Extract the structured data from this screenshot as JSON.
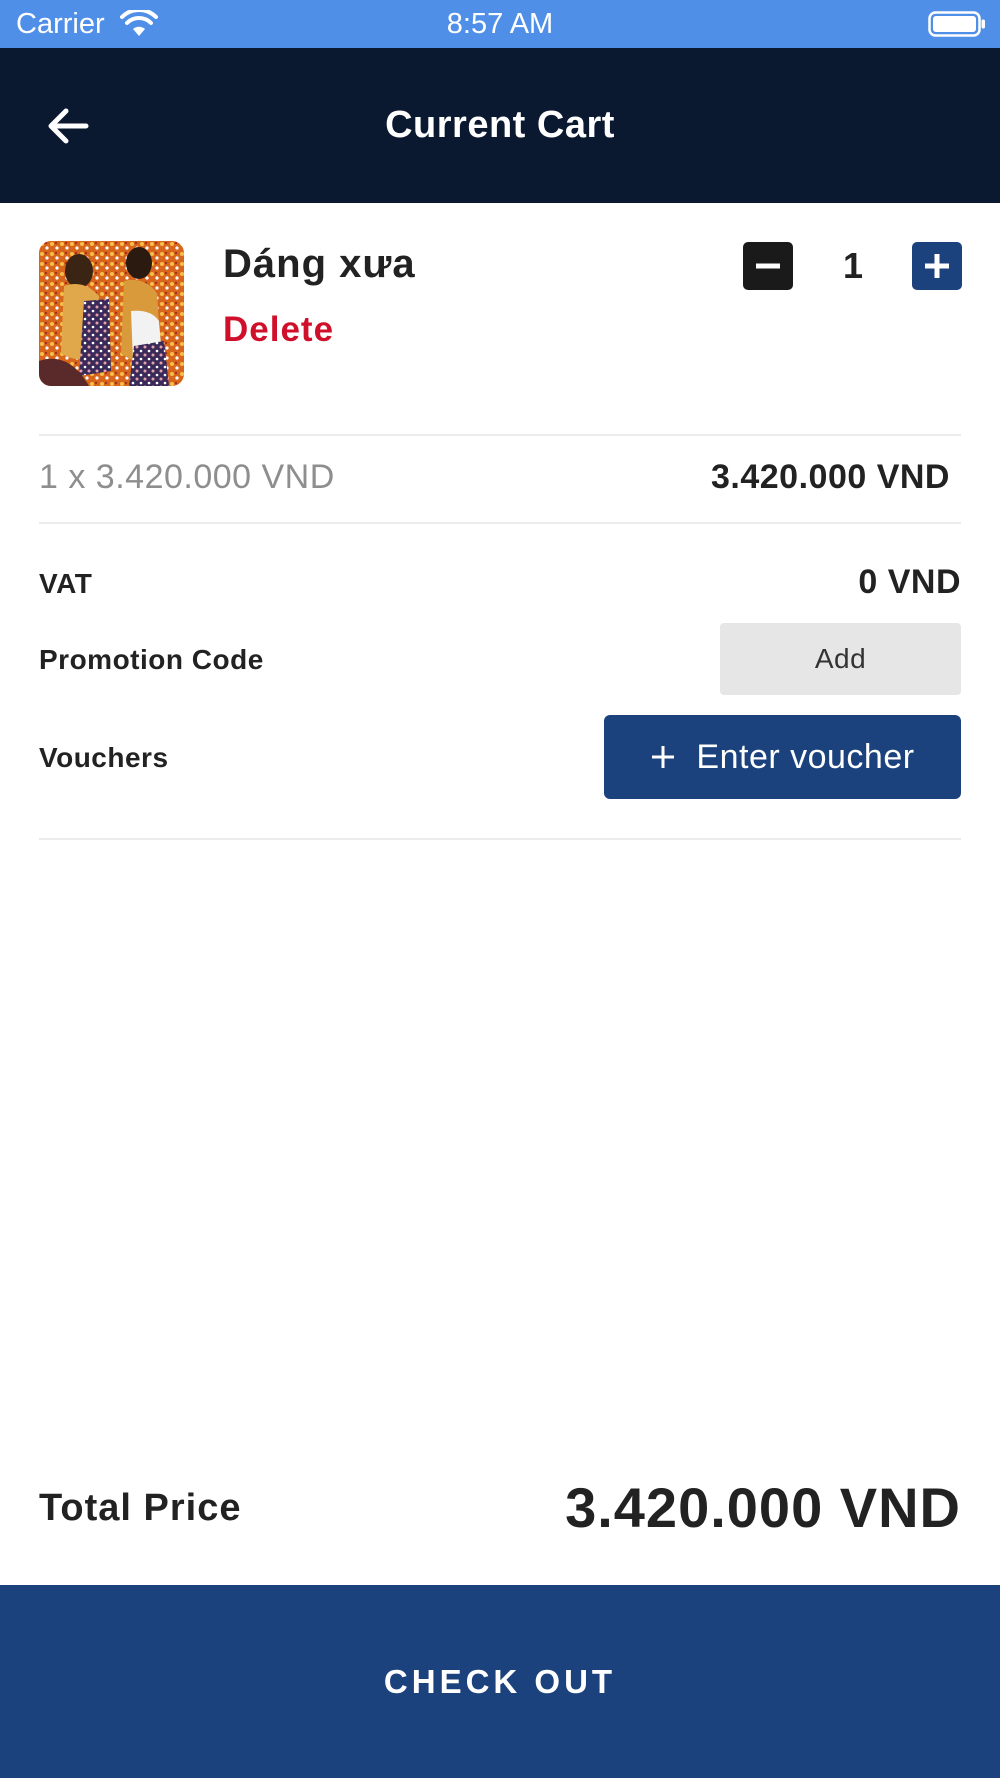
{
  "status_bar": {
    "carrier": "Carrier",
    "time": "8:57 AM",
    "wifi_icon": "wifi-icon",
    "battery_icon": "battery-full-icon"
  },
  "header": {
    "title": "Current Cart",
    "back_icon": "arrow-left-icon",
    "background": "#0b1930"
  },
  "cart": {
    "item": {
      "name": "Dáng xưa",
      "delete_label": "Delete",
      "quantity": "1",
      "unit_calc": "1 x 3.420.000 VND",
      "line_total": "3.420.000 VND",
      "thumbnail_icon": "painting-thumbnail"
    },
    "vat": {
      "label": "VAT",
      "value": "0 VND"
    },
    "promotion": {
      "label": "Promotion Code",
      "button_label": "Add"
    },
    "vouchers": {
      "label": "Vouchers",
      "button_label": "Enter voucher"
    },
    "total": {
      "label": "Total Price",
      "value": "3.420.000 VND"
    },
    "checkout_label": "CHECK OUT"
  },
  "colors": {
    "status_bar": "#4f8fe8",
    "accent": "#1c427e",
    "delete": "#d0102a",
    "minus_button": "#1a1a1a",
    "add_button": "#e6e6e6"
  }
}
